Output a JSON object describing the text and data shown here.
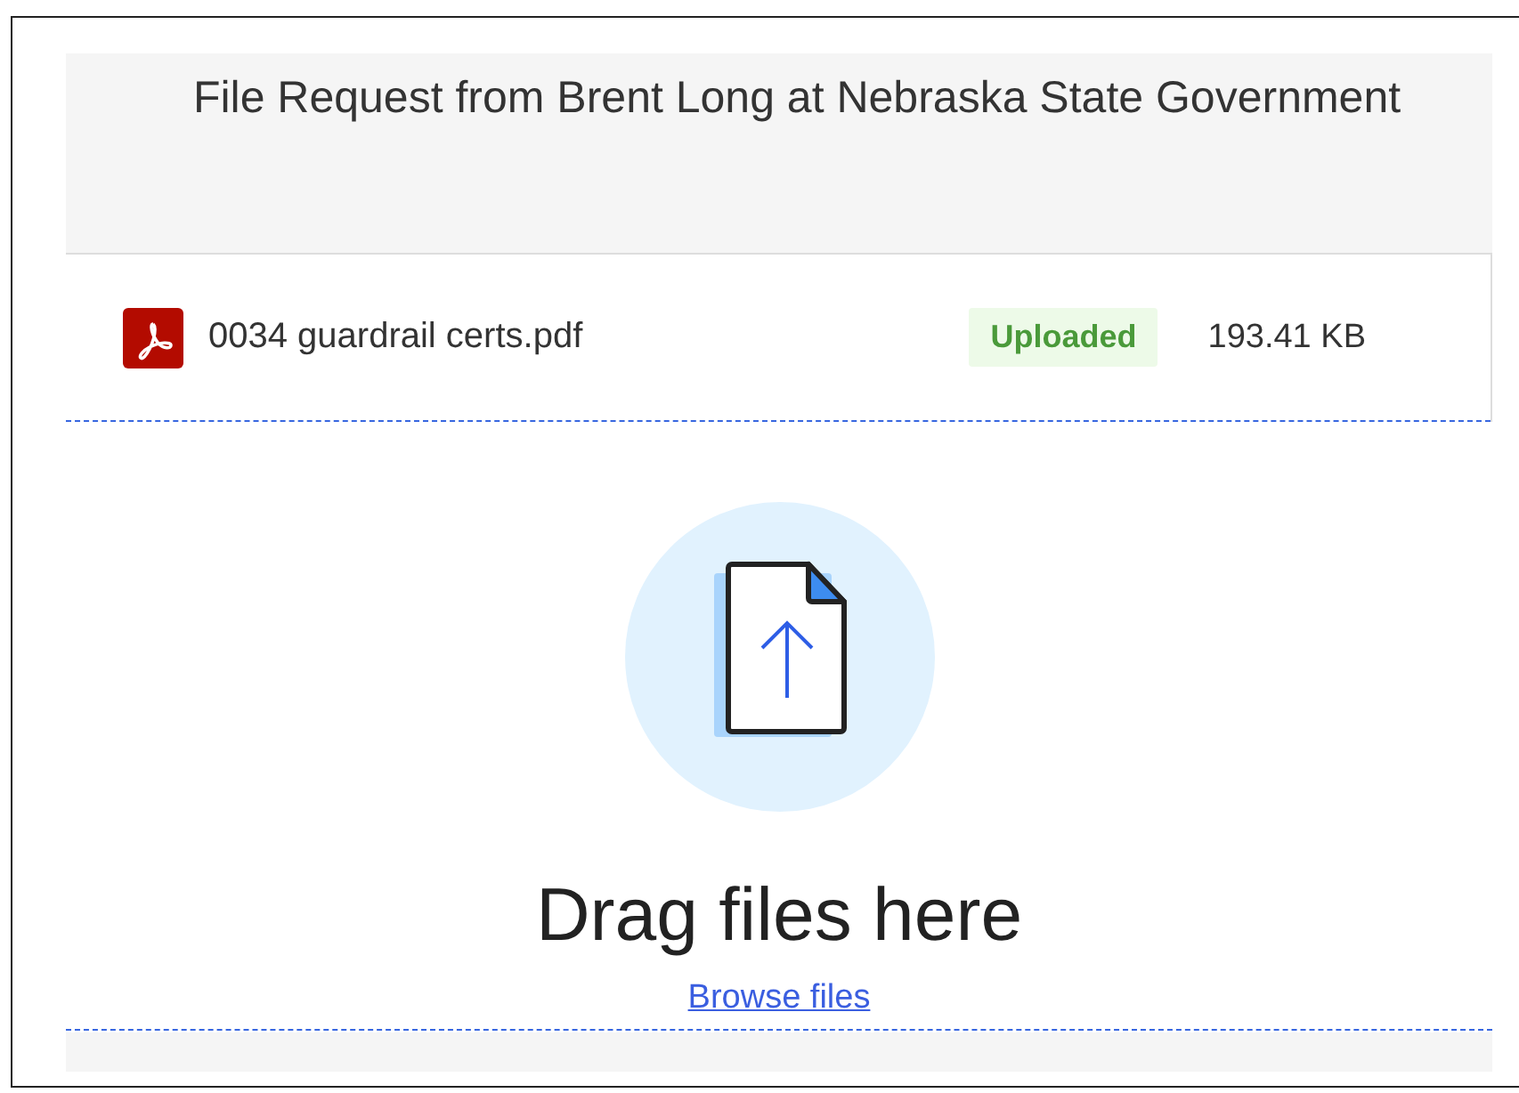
{
  "header": {
    "title": "File Request from Brent Long at Nebraska State Government"
  },
  "files": [
    {
      "name": "0034 guardrail certs.pdf",
      "kind": "pdf",
      "status": "Uploaded",
      "size": "193.41 KB"
    }
  ],
  "dropzone": {
    "heading": "Drag files here",
    "link": "Browse files"
  }
}
